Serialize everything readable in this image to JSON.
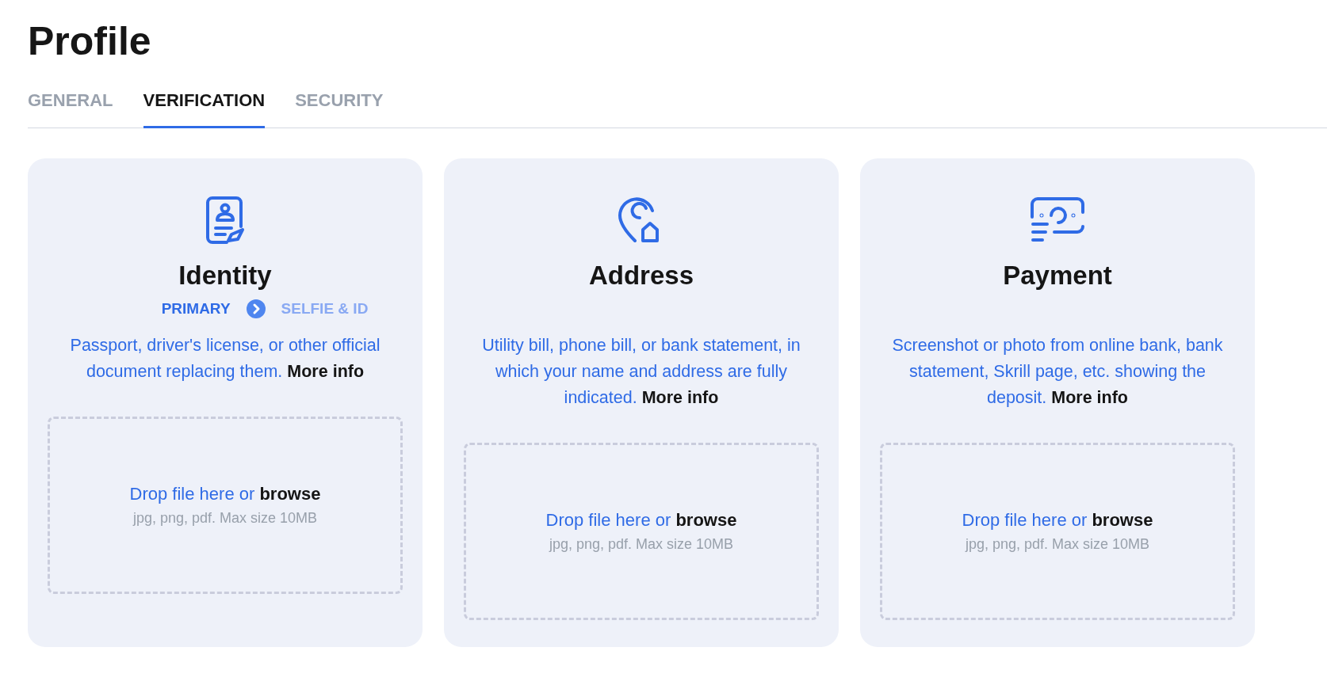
{
  "title": "Profile",
  "tabs": [
    {
      "label": "GENERAL",
      "selected": false
    },
    {
      "label": "VERIFICATION",
      "selected": true
    },
    {
      "label": "SECURITY",
      "selected": false
    }
  ],
  "cards": [
    {
      "kind": "identity",
      "title": "Identity",
      "steps": [
        {
          "label": "PRIMARY",
          "selected": true
        },
        {
          "label": "SELFIE & ID",
          "selected": false
        }
      ],
      "description": "Passport, driver's license, or other official document replacing them.",
      "link": "More info",
      "drop_text": "Drop file here or",
      "browse": "browse",
      "hint": "jpg, png, pdf. Max size 10MB"
    },
    {
      "kind": "address",
      "title": "Address",
      "description": "Utility bill, phone bill, or bank statement, in which your name and address are fully indicated.",
      "link": "More info",
      "drop_text": "Drop file here or",
      "browse": "browse",
      "hint": "jpg, png, pdf. Max size 10MB"
    },
    {
      "kind": "payment",
      "title": "Payment",
      "description": "Screenshot or photo from online bank, bank statement, Skrill page, etc. showing the deposit.",
      "link": "More info",
      "drop_text": "Drop file here or",
      "browse": "browse",
      "hint": "jpg, png, pdf. Max size 10MB"
    }
  ]
}
